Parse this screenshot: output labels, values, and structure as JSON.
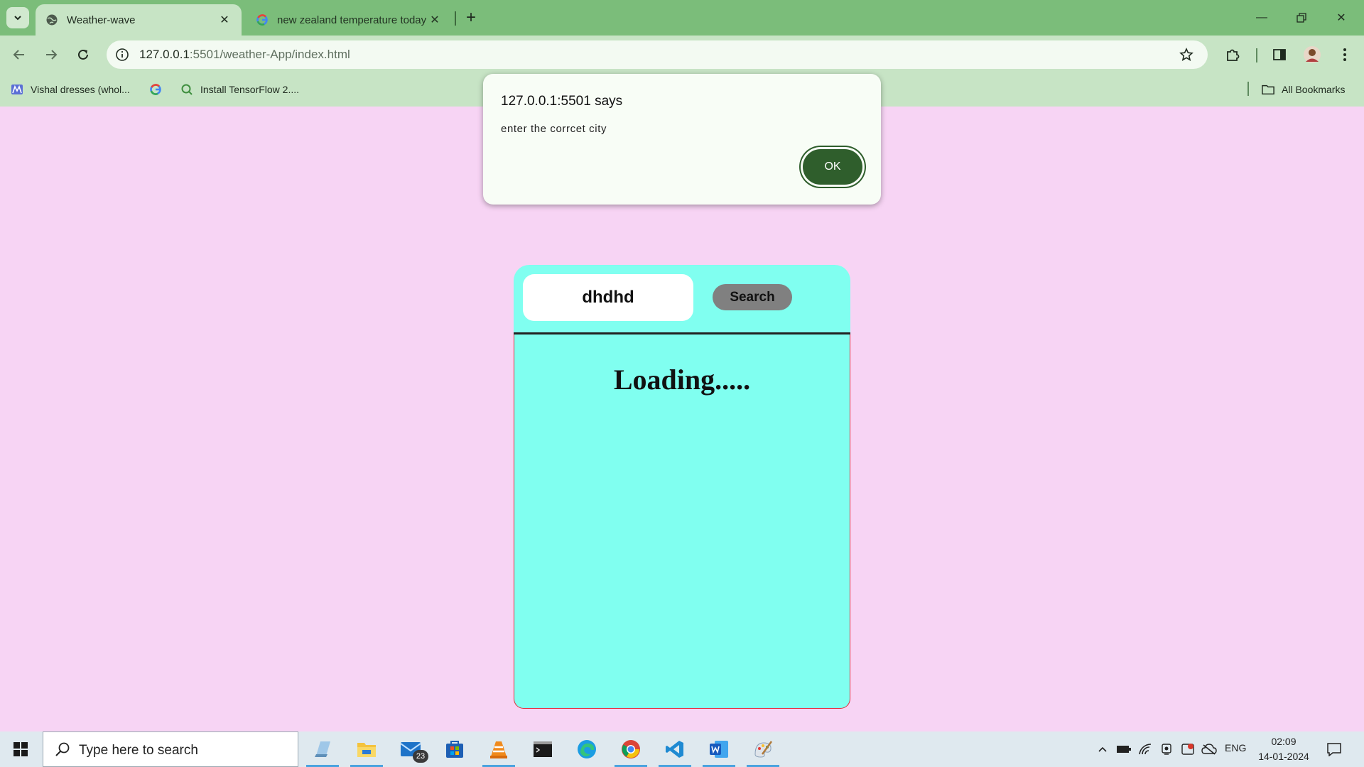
{
  "browser": {
    "tabs": [
      {
        "title": "Weather-wave",
        "active": true,
        "favicon": "globe-icon"
      },
      {
        "title": "new zealand temperature today - G",
        "active": false,
        "favicon": "google-g-icon"
      }
    ],
    "address_bar": {
      "url_host": "127.0.0.1",
      "url_rest": ":5501/weather-App/index.html"
    },
    "bookmarks": [
      {
        "label": "Vishal dresses (whol...",
        "icon": "meesho-icon"
      },
      {
        "label": "",
        "icon": "google-g-icon"
      },
      {
        "label": "Install TensorFlow 2....",
        "icon": "search-q-icon"
      }
    ],
    "all_bookmarks_label": "All Bookmarks"
  },
  "dialog": {
    "title": "127.0.0.1:5501 says",
    "message": "enter the corrcet city",
    "ok_label": "OK"
  },
  "weather_card": {
    "city_value": "dhdhd",
    "search_label": "Search",
    "status": "Loading....."
  },
  "taskbar": {
    "search_placeholder": "Type here to search",
    "mail_badge": "23",
    "language": "ENG",
    "time": "02:09",
    "date": "14-01-2024"
  },
  "colors": {
    "page_background": "#f7d4f4",
    "card_background": "#80fff0",
    "tab_strip": "#7bbd7a",
    "toolbar": "#c7e4c5",
    "dialog_button": "#2f5e2c"
  }
}
